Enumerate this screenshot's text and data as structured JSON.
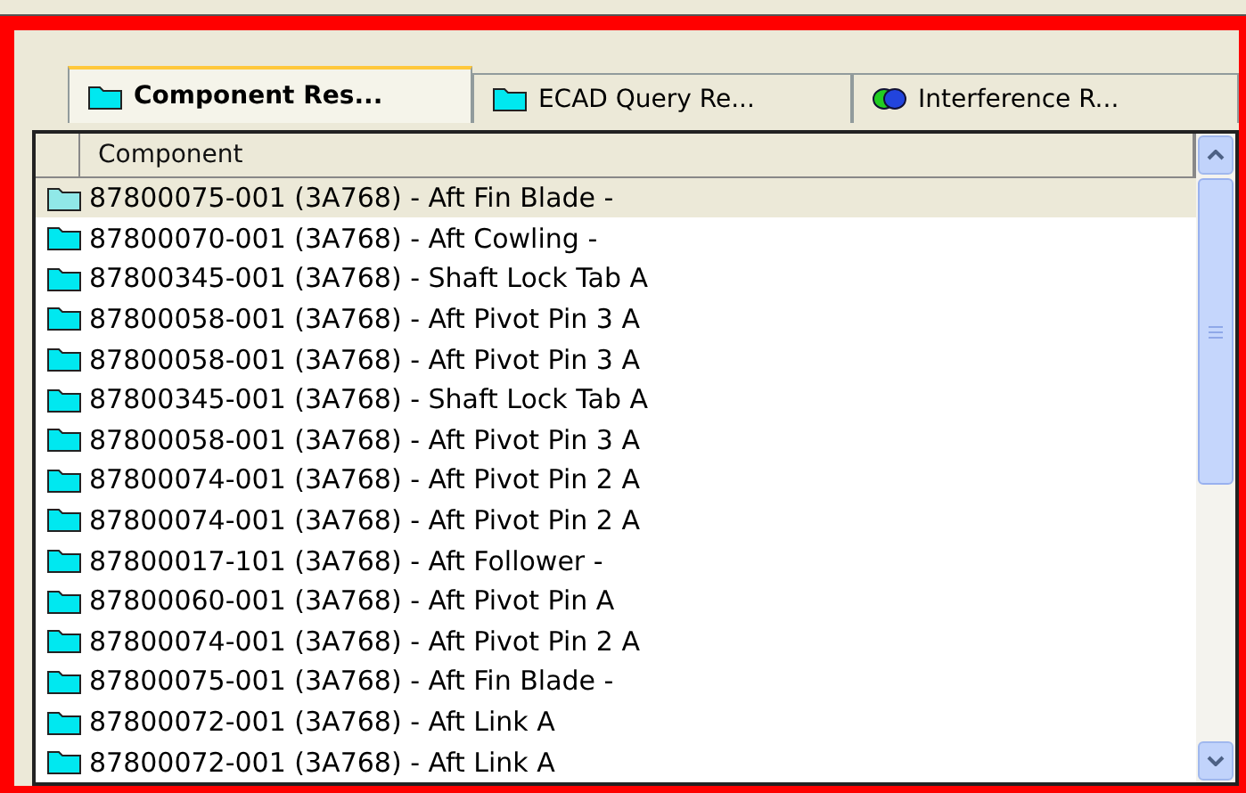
{
  "tabs": [
    {
      "label": "Component Res...",
      "kind": "folder",
      "selected": true
    },
    {
      "label": "ECAD Query Re...",
      "kind": "folder",
      "selected": false
    },
    {
      "label": "Interference R...",
      "kind": "interference",
      "selected": false
    }
  ],
  "table": {
    "columns": [
      "Component"
    ],
    "rows": [
      {
        "text": "87800075-001 (3A768) - Aft Fin Blade -",
        "selected": true
      },
      {
        "text": "87800070-001 (3A768) - Aft Cowling -",
        "selected": false
      },
      {
        "text": "87800345-001 (3A768) - Shaft Lock Tab A",
        "selected": false
      },
      {
        "text": "87800058-001 (3A768) - Aft Pivot Pin 3 A",
        "selected": false
      },
      {
        "text": "87800058-001 (3A768) - Aft Pivot Pin 3 A",
        "selected": false
      },
      {
        "text": "87800345-001 (3A768) - Shaft Lock Tab A",
        "selected": false
      },
      {
        "text": "87800058-001 (3A768) - Aft Pivot Pin 3 A",
        "selected": false
      },
      {
        "text": "87800074-001 (3A768) - Aft Pivot Pin 2 A",
        "selected": false
      },
      {
        "text": "87800074-001 (3A768) - Aft Pivot Pin 2 A",
        "selected": false
      },
      {
        "text": "87800017-101 (3A768) - Aft Follower -",
        "selected": false
      },
      {
        "text": "87800060-001 (3A768) - Aft Pivot Pin A",
        "selected": false
      },
      {
        "text": "87800074-001 (3A768) - Aft Pivot Pin 2 A",
        "selected": false
      },
      {
        "text": "87800075-001 (3A768) - Aft Fin Blade -",
        "selected": false
      },
      {
        "text": "87800072-001 (3A768) - Aft Link A",
        "selected": false
      },
      {
        "text": "87800072-001 (3A768) - Aft Link A",
        "selected": false
      }
    ]
  }
}
